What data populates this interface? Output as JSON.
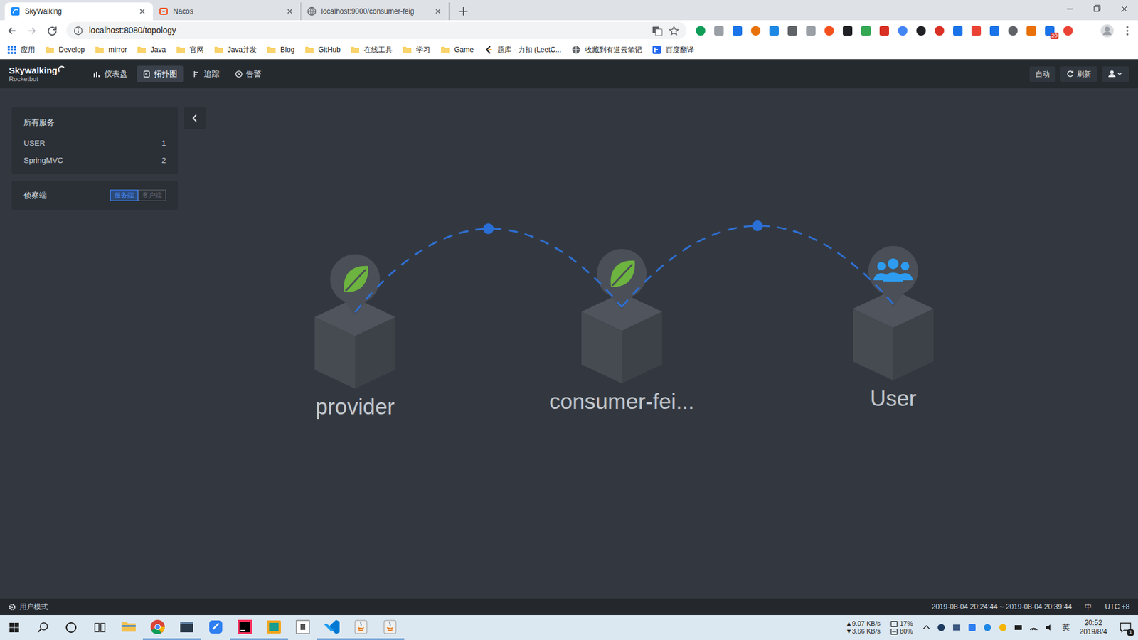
{
  "browser": {
    "tabs": [
      {
        "label": "SkyWalking",
        "kind": "skywalking",
        "selected": true
      },
      {
        "label": "Nacos",
        "kind": "nacos",
        "selected": false
      },
      {
        "label": "localhost:9000/consumer-feig",
        "kind": "globe",
        "selected": false
      }
    ],
    "url": "localhost:8080/topology",
    "extension_badge": "20",
    "bookmarks": [
      {
        "label": "应用",
        "kind": "apps"
      },
      {
        "label": "Develop",
        "kind": "folder"
      },
      {
        "label": "mirror",
        "kind": "folder"
      },
      {
        "label": "Java",
        "kind": "folder"
      },
      {
        "label": "官网",
        "kind": "folder"
      },
      {
        "label": "Java并发",
        "kind": "folder"
      },
      {
        "label": "Blog",
        "kind": "folder"
      },
      {
        "label": "GitHub",
        "kind": "folder"
      },
      {
        "label": "在线工具",
        "kind": "folder"
      },
      {
        "label": "学习",
        "kind": "folder"
      },
      {
        "label": "Game",
        "kind": "folder"
      },
      {
        "label": "题库 - 力扣 (LeetC...",
        "kind": "leetcode"
      },
      {
        "label": "收藏到有道云笔记",
        "kind": "globe"
      },
      {
        "label": "百度翻译",
        "kind": "baidu"
      }
    ]
  },
  "app": {
    "logo": "Skywalking",
    "logo_sub": "Rocketbot",
    "nav": [
      {
        "label": "仪表盘",
        "kind": "dashboard",
        "selected": false
      },
      {
        "label": "拓扑图",
        "kind": "topology",
        "selected": true
      },
      {
        "label": "追踪",
        "kind": "trace",
        "selected": false
      },
      {
        "label": "告警",
        "kind": "alarm",
        "selected": false
      }
    ],
    "auto": "自动",
    "refresh": "刷新"
  },
  "services_panel": {
    "title": "所有服务",
    "items": [
      {
        "name": "USER",
        "count": "1"
      },
      {
        "name": "SpringMVC",
        "count": "2"
      }
    ]
  },
  "probe_panel": {
    "title": "侦察端",
    "options": [
      {
        "label": "服务端",
        "selected": true
      },
      {
        "label": "客户端",
        "selected": false
      }
    ]
  },
  "topology": {
    "nodes": [
      {
        "label": "provider",
        "kind": "spring"
      },
      {
        "label": "consumer-fei...",
        "kind": "spring"
      },
      {
        "label": "User",
        "kind": "user"
      }
    ],
    "edges": [
      {
        "from": 0,
        "to": 1
      },
      {
        "from": 1,
        "to": 2
      }
    ]
  },
  "footer": {
    "mode": "用户模式",
    "range": "2019-08-04 20:24:44 ~ 2019-08-04 20:39:44",
    "lang": "中",
    "timezone": "UTC +8"
  },
  "taskbar": {
    "apps": [
      {
        "kind": "explorer",
        "running": false
      },
      {
        "kind": "chrome",
        "running": true
      },
      {
        "kind": "window",
        "running": true
      },
      {
        "kind": "note",
        "running": false
      },
      {
        "kind": "idea",
        "running": true
      },
      {
        "kind": "sandbox",
        "running": true
      },
      {
        "kind": "typora",
        "running": false
      },
      {
        "kind": "vscode",
        "running": true
      },
      {
        "kind": "java",
        "running": true
      },
      {
        "kind": "java",
        "running": true
      }
    ],
    "net_up": "▲9.07 KB/s",
    "net_down": "▼3.66 KB/s",
    "cpu": "17%",
    "mem": "80%",
    "ime": "英",
    "time": "20:52",
    "date": "2019/8/4",
    "notifications": "1"
  }
}
